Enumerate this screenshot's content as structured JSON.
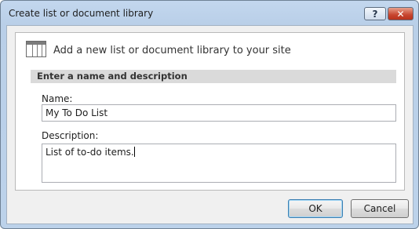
{
  "window": {
    "title": "Create list or document library",
    "help_label": "?",
    "close_label": "✕"
  },
  "panel": {
    "heading": "Add a new list or document library to your site",
    "section_title": "Enter a name and description",
    "name_label": "Name:",
    "name_value": "My To Do List",
    "description_label": "Description:",
    "description_value": "List of to-do items."
  },
  "buttons": {
    "ok": "OK",
    "cancel": "Cancel"
  }
}
